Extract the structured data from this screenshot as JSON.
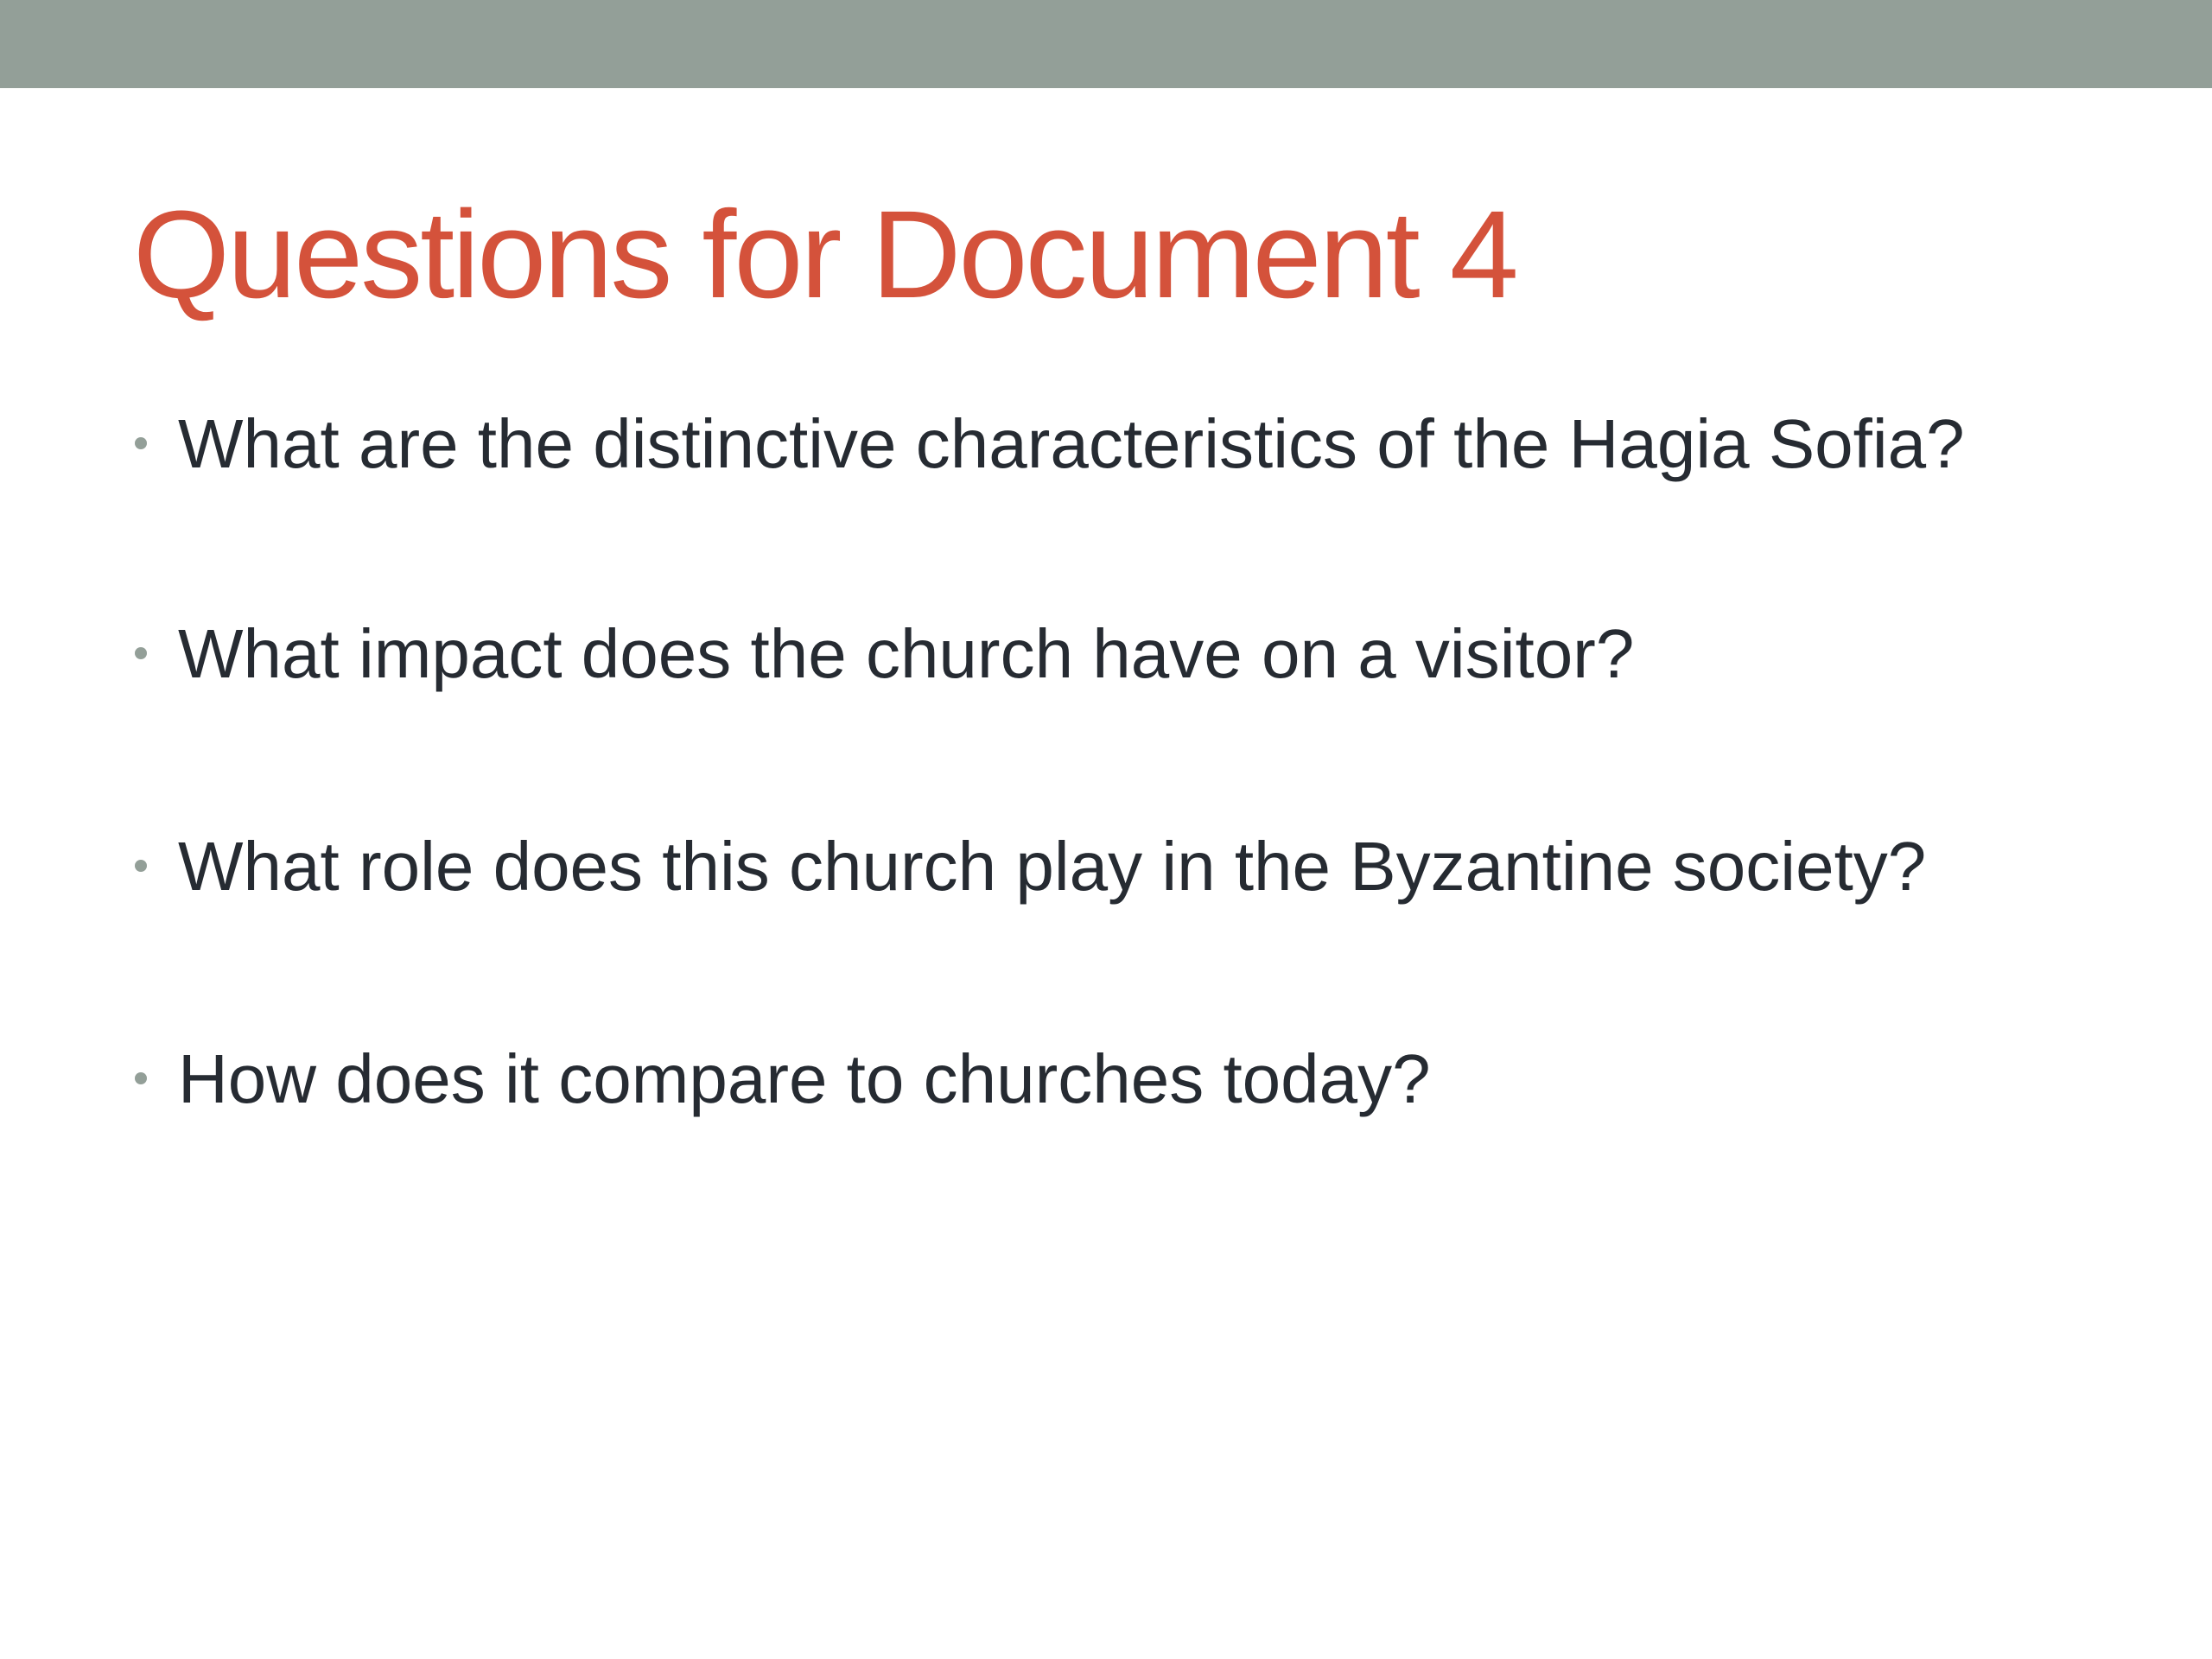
{
  "colors": {
    "top_bar": "#939f98",
    "title": "#d4523b",
    "body_text": "#262b32",
    "bullet": "#939f98"
  },
  "slide": {
    "title": "Questions for Document 4",
    "bullets": [
      {
        "text": "What are the distinctive characteristics of the Hagia Sofia?",
        "icon": "bullet-dot"
      },
      {
        "text": "What impact does the church have on a visitor?",
        "icon": "bullet-dot"
      },
      {
        "text": "What role does this church play in the Byzantine society?",
        "icon": "bullet-dot"
      },
      {
        "text": "How does it compare to churches today?",
        "icon": "bullet-dot"
      }
    ]
  }
}
